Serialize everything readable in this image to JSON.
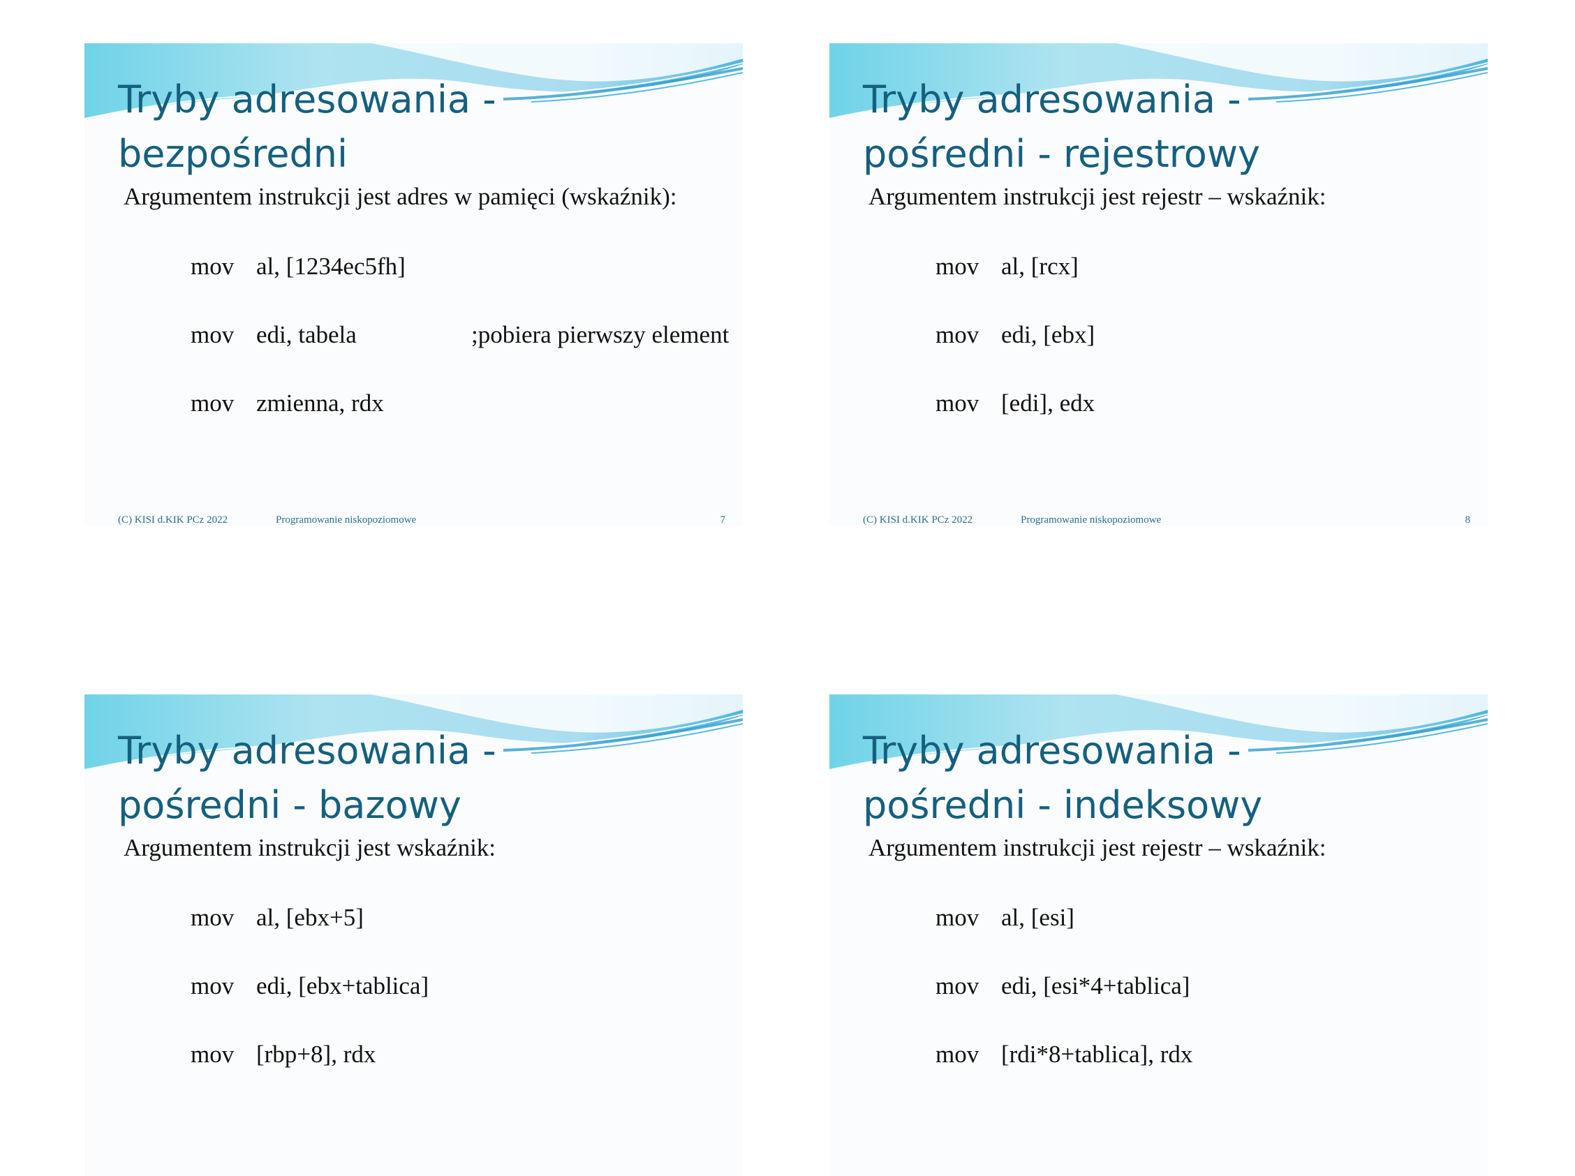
{
  "slides": [
    {
      "title_line1": "Tryby adresowania -",
      "title_line2": "bezpośredni",
      "subtitle": "Argumentem instrukcji jest adres w pamięci (wskaźnik):",
      "code": [
        {
          "op": "mov",
          "arg": "al, [1234ec5fh]",
          "comment": ""
        },
        {
          "op": "mov",
          "arg": "edi, tabela",
          "comment": ";pobiera pierwszy element"
        },
        {
          "op": "mov",
          "arg": "zmienna, rdx",
          "comment": ""
        }
      ],
      "footer": {
        "copyright": "(C) KISI d.KIK PCz 2022",
        "course": "Programowanie niskopoziomowe",
        "page": "7"
      }
    },
    {
      "title_line1": "Tryby adresowania -",
      "title_line2": "pośredni - rejestrowy",
      "subtitle": "Argumentem instrukcji jest rejestr – wskaźnik:",
      "code": [
        {
          "op": "mov",
          "arg": "al, [rcx]",
          "comment": ""
        },
        {
          "op": "mov",
          "arg": "edi, [ebx]",
          "comment": ""
        },
        {
          "op": "mov",
          "arg": "[edi], edx",
          "comment": ""
        }
      ],
      "footer": {
        "copyright": "(C) KISI d.KIK PCz 2022",
        "course": "Programowanie niskopoziomowe",
        "page": "8"
      }
    },
    {
      "title_line1": "Tryby adresowania -",
      "title_line2": "pośredni - bazowy",
      "subtitle": "Argumentem instrukcji jest wskaźnik:",
      "code": [
        {
          "op": "mov",
          "arg": "al, [ebx+5]",
          "comment": ""
        },
        {
          "op": "mov",
          "arg": "edi, [ebx+tablica]",
          "comment": ""
        },
        {
          "op": "mov",
          "arg": "[rbp+8], rdx",
          "comment": ""
        }
      ]
    },
    {
      "title_line1": "Tryby adresowania -",
      "title_line2": "pośredni - indeksowy",
      "subtitle": "Argumentem instrukcji jest rejestr – wskaźnik:",
      "code": [
        {
          "op": "mov",
          "arg": "al, [esi]",
          "comment": ""
        },
        {
          "op": "mov",
          "arg": "edi, [esi*4+tablica]",
          "comment": ""
        },
        {
          "op": "mov",
          "arg": "[rdi*8+tablica], rdx",
          "comment": ""
        }
      ]
    }
  ],
  "colors": {
    "title": "#14607e",
    "footer": "#2a6e8c",
    "wave_light": "#bfeaf3",
    "wave_mid": "#7fd3e6",
    "wave_dark": "#3aa7d4"
  }
}
